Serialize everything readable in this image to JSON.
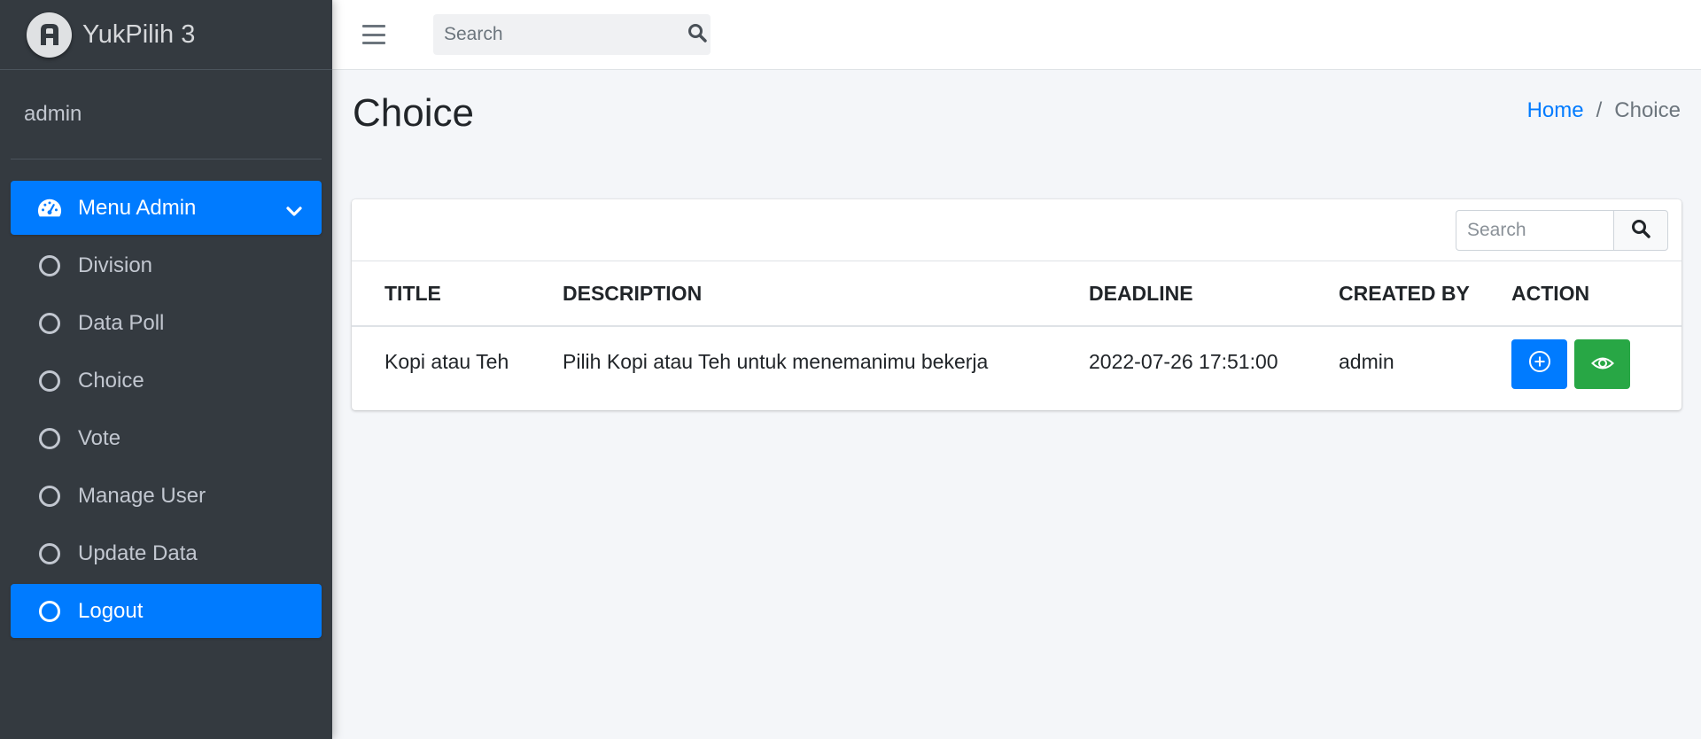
{
  "brand": {
    "name": "YukPilih 3"
  },
  "user": {
    "name": "admin"
  },
  "sidebar": {
    "items": [
      {
        "label": "Menu Admin",
        "icon": "tachometer-icon"
      },
      {
        "label": "Division",
        "icon": "circle-icon"
      },
      {
        "label": "Data Poll",
        "icon": "circle-icon"
      },
      {
        "label": "Choice",
        "icon": "circle-icon"
      },
      {
        "label": "Vote",
        "icon": "circle-icon"
      },
      {
        "label": "Manage User",
        "icon": "circle-icon"
      },
      {
        "label": "Update Data",
        "icon": "circle-icon"
      },
      {
        "label": "Logout",
        "icon": "circle-icon"
      }
    ]
  },
  "topbar": {
    "search_placeholder": "Search"
  },
  "page": {
    "title": "Choice",
    "breadcrumb": {
      "home": "Home",
      "separator": "/",
      "current": "Choice"
    }
  },
  "table": {
    "search_placeholder": "Search",
    "headers": [
      "TITLE",
      "DESCRIPTION",
      "DEADLINE",
      "CREATED BY",
      "ACTION"
    ],
    "rows": [
      {
        "title": "Kopi atau Teh",
        "description": "Pilih Kopi atau Teh untuk menemanimu bekerja",
        "deadline": "2022-07-26 17:51:00",
        "created_by": "admin",
        "actions": [
          "plus-circle-icon",
          "eye-icon"
        ]
      }
    ]
  },
  "colors": {
    "sidebar_bg": "#343a40",
    "primary": "#007bff",
    "success": "#28a745",
    "content_bg": "#f4f6f9"
  }
}
